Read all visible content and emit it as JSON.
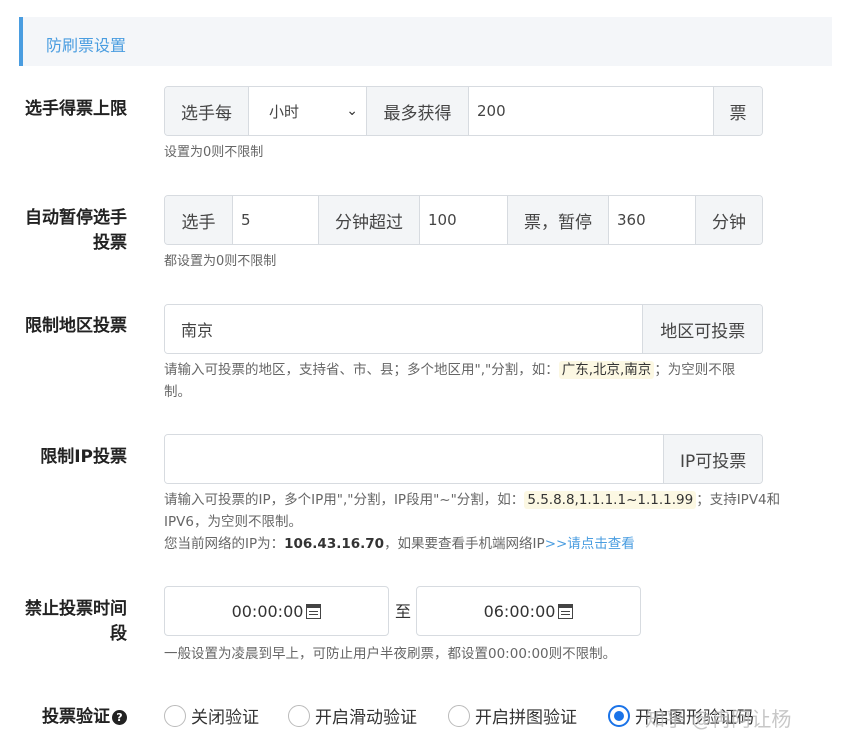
{
  "section_title": "防刷票设置",
  "rows": {
    "limit": {
      "label": "选手得票上限",
      "prefix": "选手每",
      "period_value": "小时",
      "mid": "最多获得",
      "max_votes": "200",
      "suffix": "票",
      "help": "设置为0则不限制"
    },
    "autopause": {
      "label_line1": "自动暂停选手",
      "label_line2": "投票",
      "prefix": "选手",
      "minutes": "5",
      "mid1": "分钟超过",
      "votes": "100",
      "mid2": "票，暂停",
      "pause": "360",
      "suffix": "分钟",
      "help": "都设置为0则不限制"
    },
    "region": {
      "label": "限制地区投票",
      "value": "南京",
      "suffix": "地区可投票",
      "help_pre": "请输入可投票的地区，支持省、市、县；多个地区用\",\"分割，如：",
      "help_example": "广东,北京,南京",
      "help_post": "；为空则不限",
      "help_line2": "制。"
    },
    "ip": {
      "label": "限制IP投票",
      "value": "",
      "suffix": "IP可投票",
      "help_pre": "请输入可投票的IP，多个IP用\",\"分割，IP段用\"~\"分割，如：",
      "help_example": "5.5.8.8,1.1.1.1~1.1.1.99",
      "help_post": "；支持IPV4和",
      "help_line2": "IPV6，为空则不限制。",
      "current_pre": "您当前网络的IP为：",
      "current_ip": "106.43.16.70",
      "current_mid": "，如果要查看手机端网络IP",
      "current_link": ">>请点击查看"
    },
    "time": {
      "label_line1": "禁止投票时间",
      "label_line2": "段",
      "start": "00:00:00",
      "sep": "至",
      "end": "06:00:00",
      "help": "一般设置为凌晨到早上，可防止用户半夜刷票，都设置00:00:00则不限制。"
    },
    "verify": {
      "label": "投票验证",
      "help_icon": "?",
      "options": [
        "关闭验证",
        "开启滑动验证",
        "开启拼图验证",
        "开启图形验证码"
      ],
      "selected_index": 3
    }
  },
  "watermark": "知乎 @冉阿让杨",
  "colors": {
    "accent": "#4a9de0",
    "radio": "#1a73e8",
    "highlight": "#fcf8e3"
  },
  "icons": {
    "calendar": "calendar-icon",
    "chevron": "chevron-down-icon",
    "help": "question-circle-icon"
  }
}
